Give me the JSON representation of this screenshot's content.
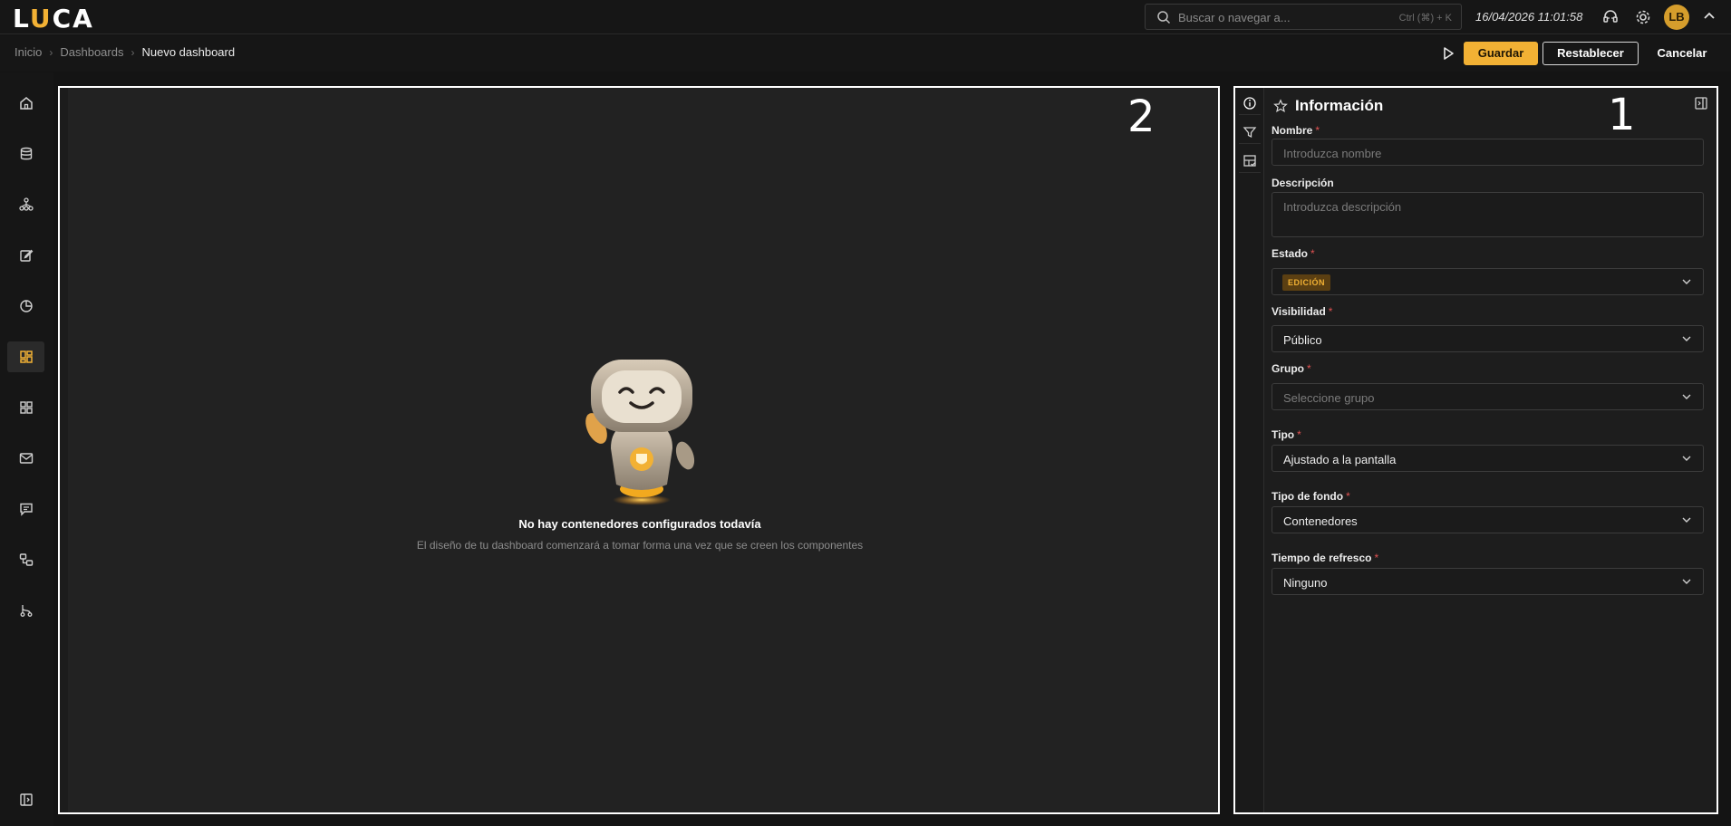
{
  "app": {
    "logo_l": "L",
    "logo_u": "U",
    "logo_ca": "CA",
    "accent": "#f2b134"
  },
  "search": {
    "placeholder": "Buscar o navegar a...",
    "shortcut": "Ctrl (⌘) + K"
  },
  "header": {
    "datetime": "16/04/2026 11:01:58",
    "avatar_initials": "LB"
  },
  "breadcrumb": {
    "items": [
      "Inicio",
      "Dashboards"
    ],
    "current": "Nuevo dashboard"
  },
  "actions": {
    "save": "Guardar",
    "reset": "Restablecer",
    "cancel": "Cancelar"
  },
  "nav": [
    "home-icon",
    "database-icon",
    "hierarchy-icon",
    "edit-icon",
    "pie-chart-icon",
    "dashboard-icon",
    "grid-icon",
    "mail-icon",
    "chat-icon",
    "workflow-icon",
    "git-branch-icon",
    "sidebar-toggle-icon"
  ],
  "canvas": {
    "marker": "2",
    "empty_title": "No hay contenedores configurados todavía",
    "empty_subtitle": "El diseño de tu dashboard comenzará a tomar forma una vez que se creen los componentes"
  },
  "panel": {
    "marker": "1",
    "title": "Información",
    "fields": {
      "nombre": {
        "label": "Nombre",
        "required": "*",
        "placeholder": "Introduzca nombre"
      },
      "descripcion": {
        "label": "Descripción",
        "placeholder": "Introduzca descripción"
      },
      "estado": {
        "label": "Estado",
        "required": "*",
        "value": "EDICIÓN"
      },
      "visibilidad": {
        "label": "Visibilidad",
        "required": "*",
        "value": "Público"
      },
      "grupo": {
        "label": "Grupo",
        "required": "*",
        "placeholder": "Seleccione grupo"
      },
      "tipo": {
        "label": "Tipo",
        "required": "*",
        "value": "Ajustado a la pantalla"
      },
      "tipo_fondo": {
        "label": "Tipo de fondo",
        "required": "*",
        "value": "Contenedores"
      },
      "refresco": {
        "label": "Tiempo de refresco",
        "required": "*",
        "value": "Ninguno"
      }
    }
  }
}
